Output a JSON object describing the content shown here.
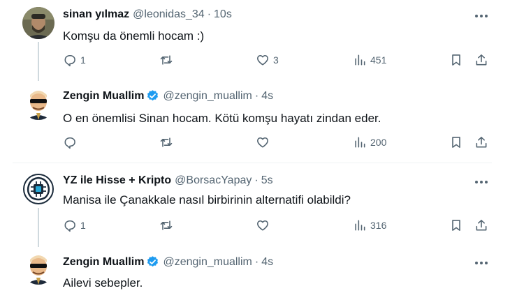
{
  "tweets": [
    {
      "name": "sinan yılmaz",
      "handle": "@leonidas_34",
      "sep": "·",
      "time": "10s",
      "text": "Komşu da önemli hocam :)",
      "verified": false,
      "avatar_icon": "profile-photo-icon",
      "replies": "1",
      "retweets": "",
      "likes": "3",
      "views": "451"
    },
    {
      "name": "Zengin Muallim",
      "handle": "@zengin_muallim",
      "sep": "·",
      "time": "4s",
      "text": "O en önemlisi Sinan hocam. Kötü komşu hayatı zindan eder.",
      "verified": true,
      "avatar_icon": "cartoon-sunglasses-avatar-icon",
      "replies": "",
      "retweets": "",
      "likes": "",
      "views": "200"
    },
    {
      "name": "YZ ile Hisse + Kripto",
      "handle": "@BorsacYapay",
      "sep": "·",
      "time": "5s",
      "text": "Manisa ile Çanakkale nasıl birbirinin alternatifi olabildi?",
      "verified": false,
      "avatar_icon": "ai-chip-brain-icon",
      "replies": "1",
      "retweets": "",
      "likes": "",
      "views": "316"
    },
    {
      "name": "Zengin Muallim",
      "handle": "@zengin_muallim",
      "sep": "·",
      "time": "4s",
      "text": "Ailevi sebepler.",
      "verified": true,
      "avatar_icon": "cartoon-sunglasses-avatar-icon"
    }
  ],
  "colors": {
    "text": "#0f1419",
    "secondary": "#536471",
    "verified": "#1d9bf0",
    "divider": "#eff3f4",
    "thread_line": "#cfd9de"
  },
  "icons": {
    "reply": "reply-icon",
    "retweet": "retweet-icon",
    "like": "heart-icon",
    "views": "views-chart-icon",
    "bookmark": "bookmark-icon",
    "share": "share-icon",
    "more": "more-dots-icon"
  }
}
